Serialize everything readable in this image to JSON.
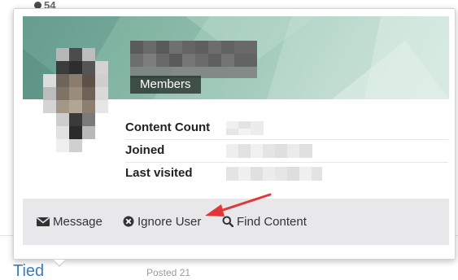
{
  "background": {
    "count": "54",
    "link_text": "Tied",
    "side_text": "Posted 21"
  },
  "card": {
    "members_label": "Members",
    "fields": [
      {
        "label": "Content Count"
      },
      {
        "label": "Joined"
      },
      {
        "label": "Last visited"
      }
    ],
    "actions": [
      {
        "label": "Message",
        "icon": "envelope-icon"
      },
      {
        "label": "Ignore User",
        "icon": "ignore-x-icon"
      },
      {
        "label": "Find Content",
        "icon": "search-icon"
      }
    ]
  },
  "annotation": {
    "arrow_color": "#e0383a"
  },
  "colors": {
    "action_bar": "#e8e8eb",
    "cover_tint": "#8cbcaa",
    "link": "#3a7cc4"
  }
}
